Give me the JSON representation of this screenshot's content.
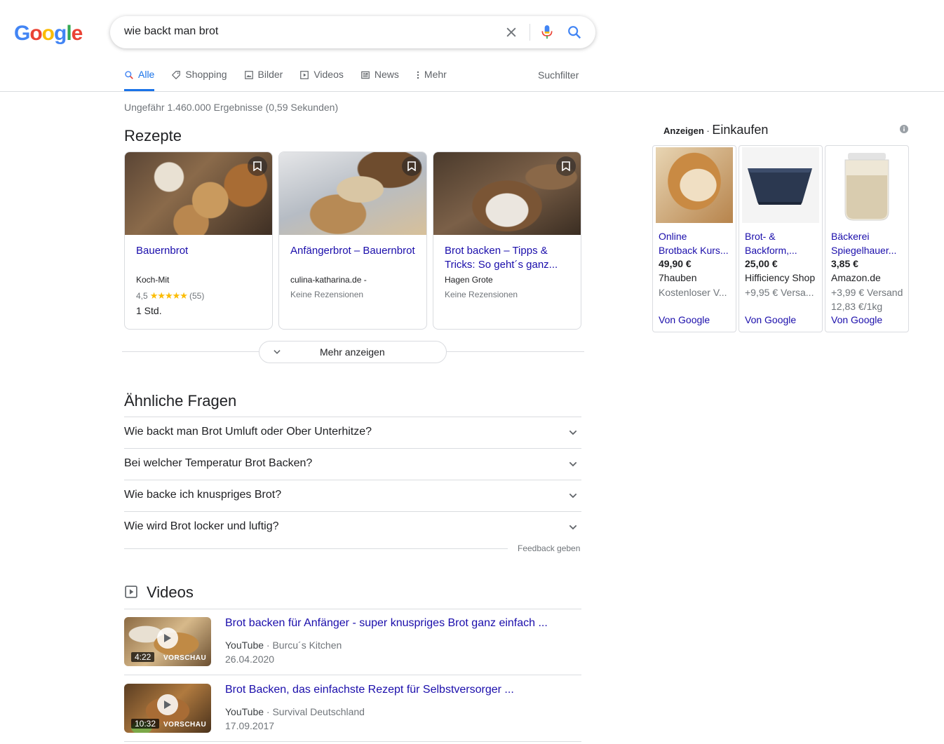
{
  "logo": {
    "letters": [
      "G",
      "o",
      "o",
      "g",
      "l",
      "e"
    ],
    "colors": [
      "#4285f4",
      "#ea4335",
      "#fbbc05",
      "#4285f4",
      "#34a853",
      "#ea4335"
    ]
  },
  "search": {
    "query": "wie backt man brot"
  },
  "tabs": [
    {
      "label": "Alle",
      "icon": "search-icon",
      "active": true
    },
    {
      "label": "Shopping",
      "icon": "tag-icon"
    },
    {
      "label": "Bilder",
      "icon": "image-icon"
    },
    {
      "label": "Videos",
      "icon": "play-icon"
    },
    {
      "label": "News",
      "icon": "newspaper-icon"
    },
    {
      "label": "Mehr",
      "icon": "more-vert-icon"
    }
  ],
  "suchfilter": "Suchfilter",
  "result_stats": "Ungefähr 1.460.000 Ergebnisse (0,59 Sekunden)",
  "recipes": {
    "heading": "Rezepte",
    "items": [
      {
        "title": "Bauernbrot",
        "source": "Koch-Mit",
        "rating": "4,5",
        "stars": "★★★★★",
        "count": "(55)",
        "time": "1 Std."
      },
      {
        "title": "Anfängerbrot – Bauernbrot",
        "source": "culina-katharina.de -",
        "reviews": "Keine Rezensionen"
      },
      {
        "title": "Brot backen – Tipps & Tricks: So geht´s ganz...",
        "source": "Hagen Grote",
        "reviews": "Keine Rezensionen"
      }
    ],
    "more_label": "Mehr anzeigen"
  },
  "questions": {
    "heading": "Ähnliche Fragen",
    "items": [
      "Wie backt man Brot Umluft oder Ober Unterhitze?",
      "Bei welcher Temperatur Brot Backen?",
      "Wie backe ich knuspriges Brot?",
      "Wie wird Brot locker und luftig?"
    ],
    "feedback": "Feedback geben"
  },
  "videos": {
    "heading": "Videos",
    "items": [
      {
        "title": "Brot backen für Anfänger - super knuspriges Brot ganz einfach ...",
        "platform": "YouTube",
        "channel": " · Burcu´s Kitchen",
        "date": "26.04.2020",
        "duration": "4:22",
        "preview": "VORSCHAU"
      },
      {
        "title": "Brot Backen, das einfachste Rezept für Selbstversorger ...",
        "platform": "YouTube",
        "channel": " · Survival Deutschland",
        "date": "17.09.2017",
        "duration": "10:32",
        "preview": "VORSCHAU"
      }
    ]
  },
  "ads": {
    "label": "Anzeigen",
    "sep": " · ",
    "title": "Einkaufen",
    "items": [
      {
        "title1": "Online",
        "title2": "Brotback Kurs...",
        "price": "49,90 €",
        "store": "7hauben",
        "shipping": "Kostenloser V...",
        "unit": "",
        "von": "Von Google"
      },
      {
        "title1": "Brot- &",
        "title2": "Backform,...",
        "price": "25,00 €",
        "store": "Hifficiency Shop",
        "shipping": "+9,95 € Versa...",
        "unit": "",
        "von": "Von Google"
      },
      {
        "title1": "Bäckerei",
        "title2": "Spiegelhauer...",
        "price": "3,85 €",
        "store": "Amazon.de",
        "shipping": "+3,99 € Versand",
        "unit": "12,83 €/1kg",
        "von": "Von Google"
      }
    ]
  }
}
